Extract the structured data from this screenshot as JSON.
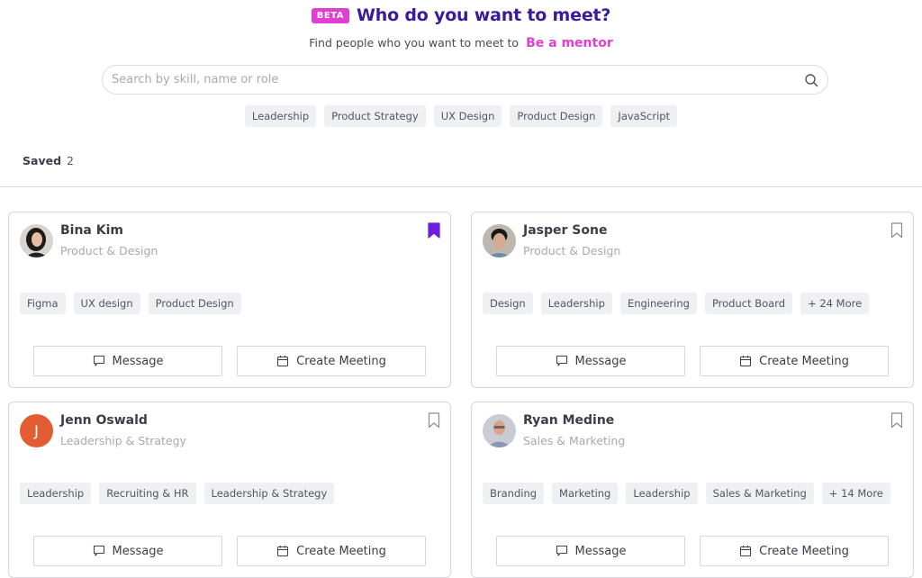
{
  "header": {
    "beta_badge": "BETA",
    "title": "Who do you want to meet?",
    "subtitle": "Find people who you want to meet to",
    "mentor_link": "Be a mentor"
  },
  "search": {
    "placeholder": "Search by skill, name or role",
    "value": ""
  },
  "suggested_chips": [
    "Leadership",
    "Product Strategy",
    "UX Design",
    "Product Design",
    "JavaScript"
  ],
  "saved": {
    "label": "Saved",
    "count": "2"
  },
  "buttons": {
    "message": "Message",
    "create_meeting": "Create Meeting"
  },
  "colors": {
    "accent_purple": "#3b1a9c",
    "accent_pink": "#e13fd0",
    "bookmark_saved": "#6a1fe0",
    "avatar_orange": "#e35d33"
  },
  "people": [
    {
      "name": "Bina Kim",
      "role": "Product & Design",
      "saved": true,
      "avatar": "photo",
      "tags": [
        "Figma",
        "UX design",
        "Product Design"
      ]
    },
    {
      "name": "Jasper Sone",
      "role": "Product & Design",
      "saved": false,
      "avatar": "photo",
      "tags": [
        "Design",
        "Leadership",
        "Engineering",
        "Product Board",
        "+ 24 More"
      ]
    },
    {
      "name": "Jenn Oswald",
      "role": "Leadership & Strategy",
      "saved": false,
      "avatar": "initial",
      "initial": "J",
      "tags": [
        "Leadership",
        "Recruiting & HR",
        "Leadership & Strategy"
      ]
    },
    {
      "name": "Ryan Medine",
      "role": "Sales & Marketing",
      "saved": false,
      "avatar": "photo",
      "tags": [
        "Branding",
        "Marketing",
        "Leadership",
        "Sales & Marketing",
        "+ 14 More"
      ]
    }
  ]
}
